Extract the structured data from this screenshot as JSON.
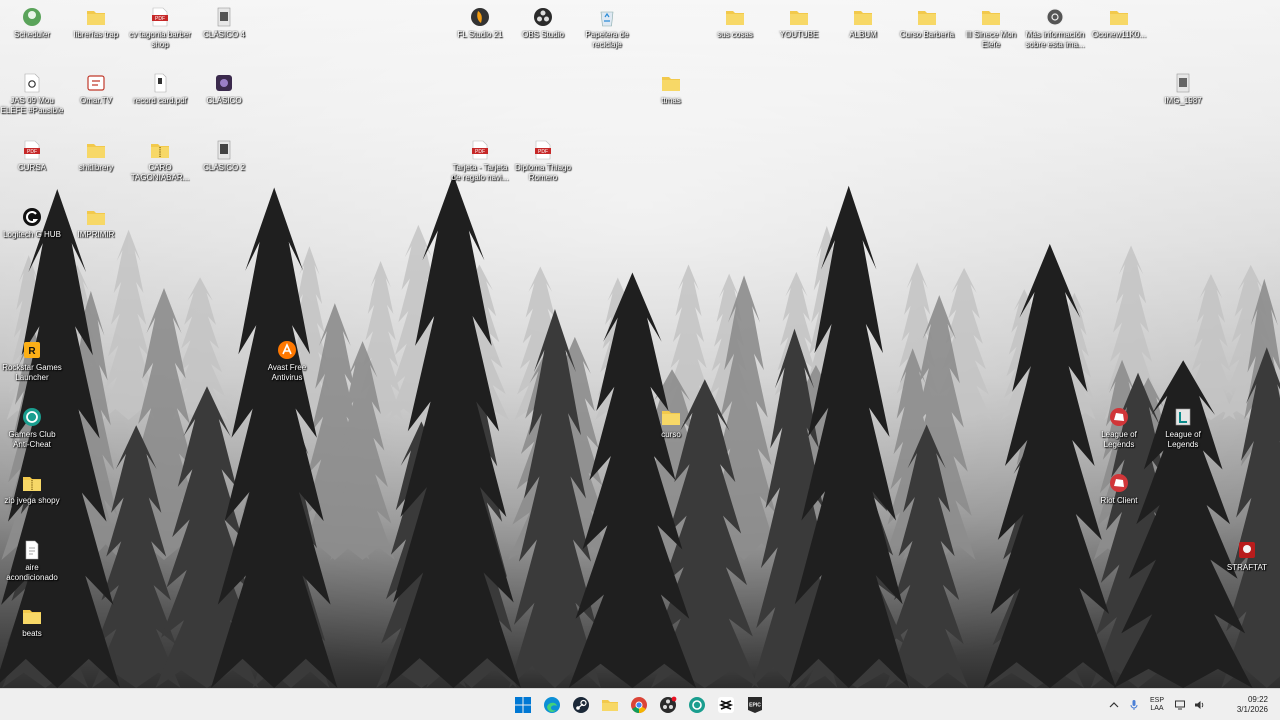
{
  "desktop": {
    "icons": [
      {
        "label": "Scheduler",
        "icon": "scheduler-icon"
      },
      {
        "label": "librerías trap",
        "icon": "folder-icon"
      },
      {
        "label": "cv tagonia barber shop",
        "icon": "pdf-file-icon"
      },
      {
        "label": "CLÁSICO 4",
        "icon": "image-file-icon"
      },
      {
        "label": "FL Studio 21",
        "icon": "fl-studio-icon"
      },
      {
        "label": "OBS Studio",
        "icon": "obs-studio-icon"
      },
      {
        "label": "Papelera de reciclaje",
        "icon": "recycle-bin-icon"
      },
      {
        "label": "sus cosas",
        "icon": "folder-icon"
      },
      {
        "label": "YOUTUBE",
        "icon": "folder-icon"
      },
      {
        "label": "ALBUM",
        "icon": "folder-icon"
      },
      {
        "label": "Curso Barbería",
        "icon": "folder-icon"
      },
      {
        "label": "Ill Sinece Mon Elefe",
        "icon": "folder-icon"
      },
      {
        "label": "Más información sobre esta ima...",
        "icon": "info-camera-icon"
      },
      {
        "label": "Oconew11K0...",
        "icon": "folder-icon"
      },
      {
        "label": "JAS 09 Mou ELÉFE #Pausible",
        "icon": "audio-file-icon"
      },
      {
        "label": "Omar.TV",
        "icon": "omar-tv-icon"
      },
      {
        "label": "record card.pdf",
        "icon": "file-icon"
      },
      {
        "label": "CLÁSICO",
        "icon": "video-file-icon"
      },
      {
        "label": "ttmas",
        "icon": "folder-icon"
      },
      {
        "label": "IMG_1987",
        "icon": "image-file-icon"
      },
      {
        "label": "CURSA",
        "icon": "pdf-file-icon"
      },
      {
        "label": "shitlibrery",
        "icon": "folder-icon"
      },
      {
        "label": "CARO TAGONIABAR...",
        "icon": "zip-folder-icon"
      },
      {
        "label": "CLÁSICO 2",
        "icon": "image-file-icon"
      },
      {
        "label": "Tarjeta - Tarjeta de regalo navi...",
        "icon": "pdf-file-icon"
      },
      {
        "label": "Diploma Thiago Romero",
        "icon": "pdf-file-icon"
      },
      {
        "label": "Logitech G HUB",
        "icon": "logitech-ghub-icon"
      },
      {
        "label": "IMPRIMIR",
        "icon": "folder-icon"
      },
      {
        "label": "Rockstar Games Launcher",
        "icon": "rockstar-games-icon"
      },
      {
        "label": "Avast Free Antivirus",
        "icon": "avast-icon"
      },
      {
        "label": "Gamers Club Anti-Cheat",
        "icon": "gamers-club-icon"
      },
      {
        "label": "curso",
        "icon": "folder-icon"
      },
      {
        "label": "League of Legends",
        "icon": "riot-icon"
      },
      {
        "label": "League of Legends",
        "icon": "league-of-legends-icon"
      },
      {
        "label": "zip jvega shopy",
        "icon": "zip-folder-icon"
      },
      {
        "label": "Riot Client",
        "icon": "riot-icon"
      },
      {
        "label": "aire acondicionado",
        "icon": "file-icon"
      },
      {
        "label": "STRAFTAT",
        "icon": "straftat-icon"
      },
      {
        "label": "beats",
        "icon": "folder-icon"
      }
    ]
  },
  "taskbar": {
    "apps": [
      {
        "name": "Inicio",
        "icon": "windows-start-icon"
      },
      {
        "name": "Microsoft Edge",
        "icon": "edge-icon"
      },
      {
        "name": "Steam",
        "icon": "steam-icon"
      },
      {
        "name": "Explorador de archivos",
        "icon": "file-explorer-icon"
      },
      {
        "name": "Google Chrome",
        "icon": "chrome-icon"
      },
      {
        "name": "OBS Studio",
        "icon": "obs-studio-icon"
      },
      {
        "name": "Gamers Club",
        "icon": "gamers-club-icon"
      },
      {
        "name": "CapCut",
        "icon": "capcut-icon"
      },
      {
        "name": "Epic Games Launcher",
        "icon": "epic-games-icon"
      }
    ],
    "tray": {
      "language_line1": "ESP",
      "language_line2": "LAA",
      "time": "09:22",
      "date": "3/1/2026"
    }
  },
  "colors": {
    "folder": "#f2c94c",
    "pdf": "#c62828",
    "taskbar_bg": "#efefef",
    "start_blue": "#0078d4"
  }
}
